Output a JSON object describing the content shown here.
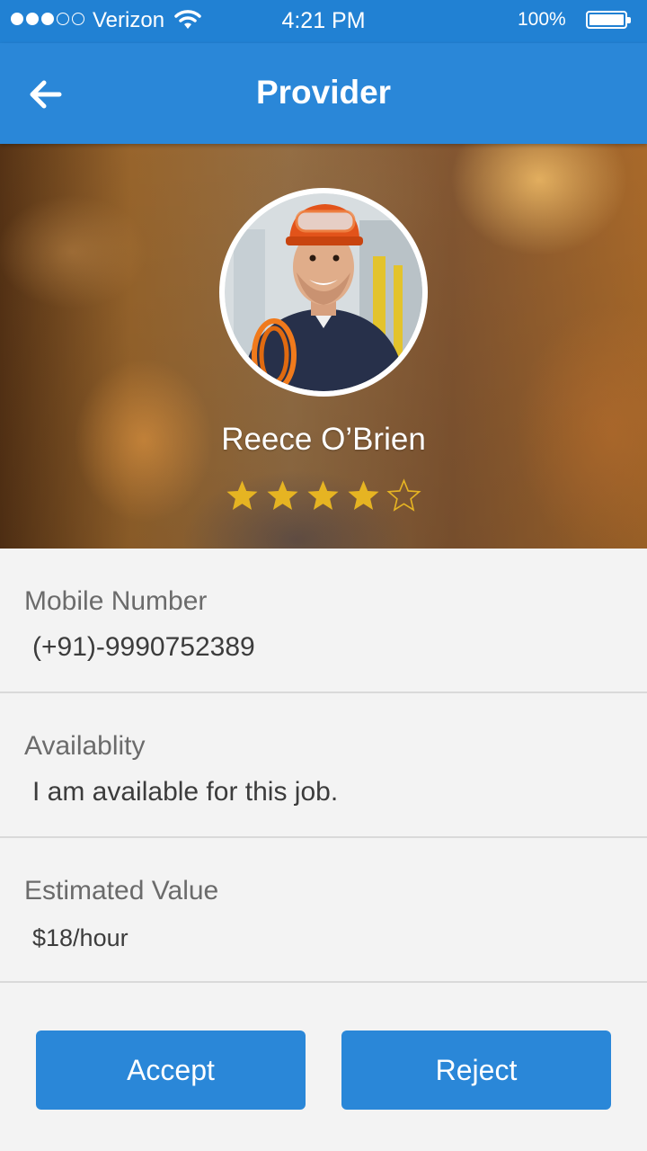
{
  "status_bar": {
    "carrier": "Verizon",
    "time": "4:21 PM",
    "battery": "100%",
    "signal_bars_filled": 3,
    "signal_bars_total": 5
  },
  "header": {
    "title": "Provider",
    "back_icon": "arrow-left-icon"
  },
  "provider": {
    "name": "Reece O’Brien",
    "rating": 4,
    "rating_max": 5
  },
  "fields": {
    "mobile": {
      "label": "Mobile Number",
      "value": "(+91)-9990752389"
    },
    "availability": {
      "label": "Availablity",
      "value": "I am available for this job."
    },
    "estimate": {
      "label": "Estimated Value",
      "value": "$18/hour"
    }
  },
  "actions": {
    "accept_label": "Accept",
    "reject_label": "Reject"
  },
  "colors": {
    "primary": "#2a87d8",
    "status_bar": "#2181d3",
    "star": "#e6b422"
  }
}
